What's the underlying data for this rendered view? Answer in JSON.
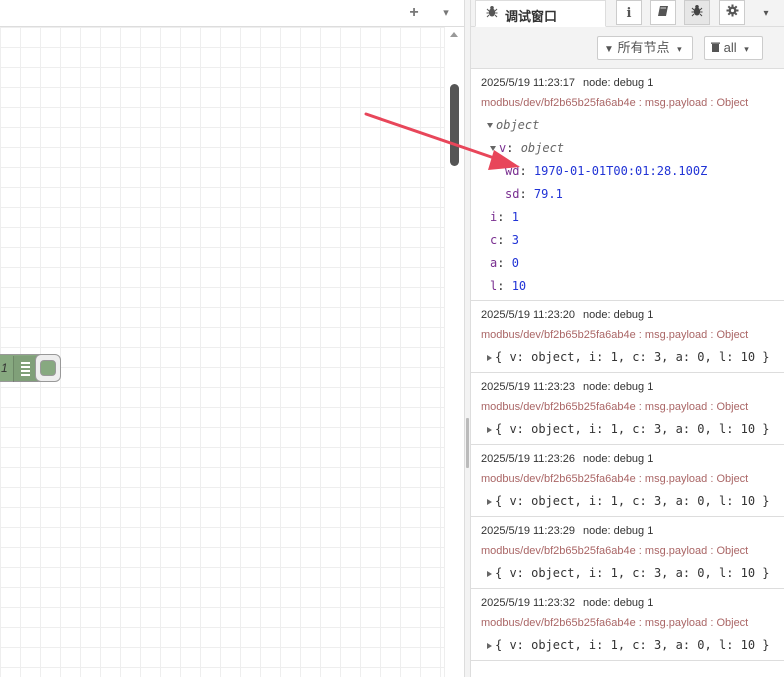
{
  "workspace": {
    "add_icon": "+",
    "menu_icon": "▾",
    "node": {
      "label": "1"
    }
  },
  "sidebar": {
    "debug_tab": {
      "label": "调试窗口",
      "icon": "bug-icon"
    },
    "tab_icons": [
      "info-icon",
      "book-icon",
      "bug-icon",
      "gear-icon"
    ],
    "toolbar": {
      "filter_label": "所有节点",
      "clear_label": "all"
    },
    "messages": [
      {
        "time": "2025/5/19 11:23:17",
        "node": "node: debug 1",
        "topic": "modbus/dev/bf2b65b25fa6ab4e : msg.payload : Object",
        "expanded": true,
        "root_label": "object",
        "v_key": "v",
        "v_type": "object",
        "wd_key": "wd",
        "wd_val": "1970-01-01T00:01:28.100Z",
        "sd_key": "sd",
        "sd_val": "79.1",
        "i_key": "i",
        "i_val": "1",
        "c_key": "c",
        "c_val": "3",
        "a_key": "a",
        "a_val": "0",
        "l_key": "l",
        "l_val": "10"
      },
      {
        "time": "2025/5/19 11:23:20",
        "node": "node: debug 1",
        "topic": "modbus/dev/bf2b65b25fa6ab4e : msg.payload : Object",
        "summary": "{ v: object, i: 1, c: 3, a: 0, l: 10 }"
      },
      {
        "time": "2025/5/19 11:23:23",
        "node": "node: debug 1",
        "topic": "modbus/dev/bf2b65b25fa6ab4e : msg.payload : Object",
        "summary": "{ v: object, i: 1, c: 3, a: 0, l: 10 }"
      },
      {
        "time": "2025/5/19 11:23:26",
        "node": "node: debug 1",
        "topic": "modbus/dev/bf2b65b25fa6ab4e : msg.payload : Object",
        "summary": "{ v: object, i: 1, c: 3, a: 0, l: 10 }"
      },
      {
        "time": "2025/5/19 11:23:29",
        "node": "node: debug 1",
        "topic": "modbus/dev/bf2b65b25fa6ab4e : msg.payload : Object",
        "summary": "{ v: object, i: 1, c: 3, a: 0, l: 10 }"
      },
      {
        "time": "2025/5/19 11:23:32",
        "node": "node: debug 1",
        "topic": "modbus/dev/bf2b65b25fa6ab4e : msg.payload : Object",
        "summary": "{ v: object, i: 1, c: 3, a: 0, l: 10 }"
      }
    ]
  },
  "colors": {
    "node_fill": "#87a980",
    "annotation_arrow": "#e8465a",
    "key_color": "#792e90",
    "number_color": "#2033d6",
    "topic_color": "#a66666"
  }
}
